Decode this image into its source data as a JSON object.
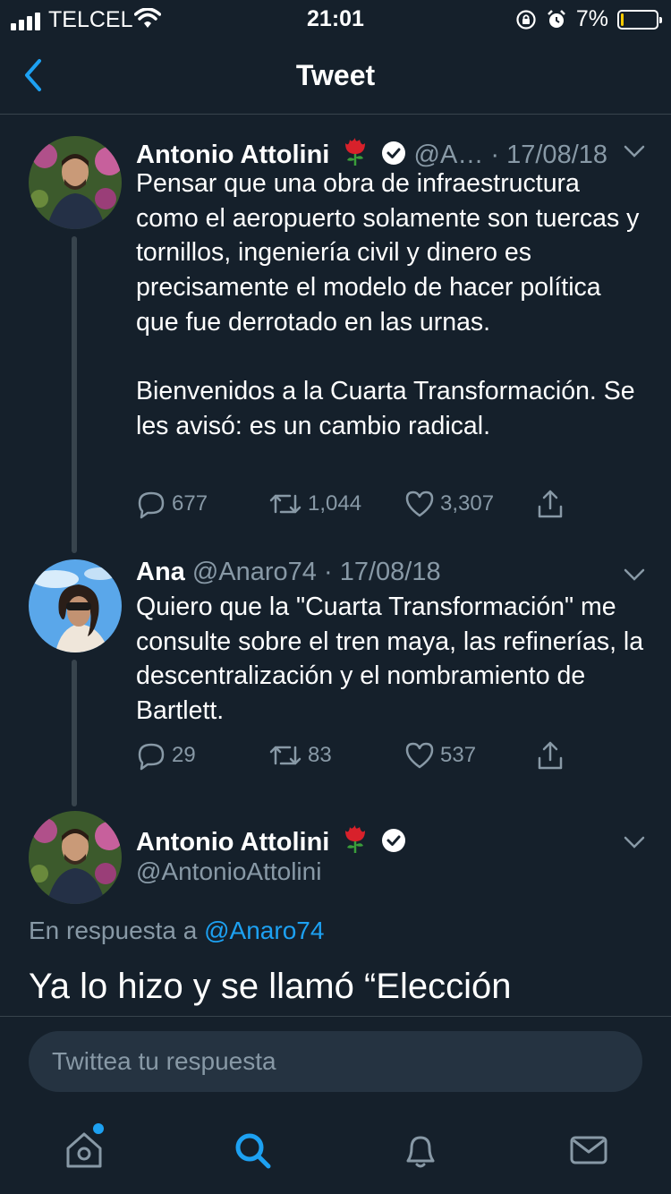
{
  "status_bar": {
    "carrier": "TELCEL",
    "time": "21:01",
    "battery_percent": "7%",
    "battery_level": 0.07,
    "icons": [
      "signal-icon",
      "wifi-icon",
      "rotation-lock-icon",
      "alarm-icon",
      "battery-icon"
    ]
  },
  "nav": {
    "title": "Tweet",
    "back_icon": "chevron-left-icon"
  },
  "tweets": [
    {
      "name": "Antonio Attolini",
      "handle": "@A…",
      "date": "· 17/08/18",
      "text": "Pensar que una obra de infraestructura como el aeropuerto solamente son tuercas y tornillos, ingeniería civil y dinero es precisamente el modelo de hacer política que fue derrotado en las urnas.\n\nBienvenidos a la Cuarta Transformación. Se les avisó: es un cambio radical.",
      "replies": "677",
      "retweets": "1,044",
      "likes": "3,307"
    },
    {
      "name": "Ana",
      "handle": "@Anaro74",
      "date": "· 17/08/18",
      "text": "Quiero que la \"Cuarta Transformación\" me consulte sobre el tren maya, las refinerías, la descentralización y el nombramiento de Bartlett.",
      "replies": "29",
      "retweets": "83",
      "likes": "537"
    },
    {
      "name": "Antonio Attolini",
      "handle": "@AntonioAttolini",
      "reply_prefix": "En respuesta a",
      "reply_to": "@Anaro74",
      "text": "Ya lo hizo y se llamó “Elección"
    }
  ],
  "reply_bar": {
    "placeholder": "Twittea tu respuesta"
  },
  "tabbar": {
    "tabs": [
      "home-icon",
      "search-icon",
      "notifications-icon",
      "messages-icon"
    ],
    "active": "search-icon"
  },
  "colors": {
    "background": "#15202b",
    "accent": "#1da1f2",
    "secondary_text": "#8899a6",
    "divider": "#38444d",
    "battery": "#ffcc00"
  }
}
